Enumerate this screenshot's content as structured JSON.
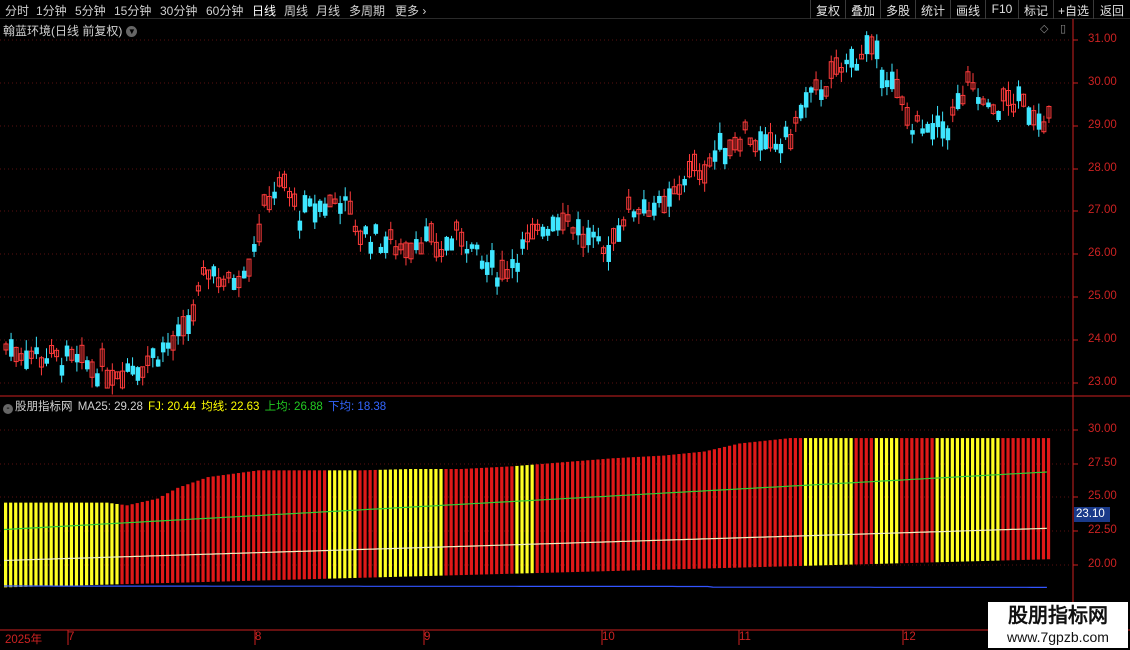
{
  "toolbar": {
    "timeframes": [
      "分时",
      "1分钟",
      "5分钟",
      "15分钟",
      "30分钟",
      "60分钟",
      "日线",
      "周线",
      "月线",
      "多周期",
      "更多"
    ],
    "more_arrow": "›",
    "right_buttons": [
      "复权",
      "叠加",
      "多股",
      "统计",
      "画线",
      "F10",
      "标记",
      "+自选",
      "返回"
    ]
  },
  "main_chart": {
    "title": "翰蓝环境(日线 前复权)",
    "y_ticks": [
      "31.00",
      "30.00",
      "29.00",
      "28.00",
      "27.00",
      "26.00",
      "25.00",
      "24.00",
      "23.00"
    ],
    "colors": {
      "up": "#ff3333",
      "down": "#33e6ff",
      "grid": "#6b1010"
    }
  },
  "indicator": {
    "name": "股朋指标网",
    "ma25": "MA25: 29.28",
    "fj": "FJ: 20.44",
    "junxian": "均线: 22.63",
    "shangjun": "上均: 26.88",
    "xiajun": "下均: 18.38",
    "y_ticks": [
      "30.00",
      "27.50",
      "25.00",
      "22.50",
      "20.00"
    ],
    "current_value": "23.10"
  },
  "x_axis": {
    "labels": [
      "2025年",
      "7",
      "8",
      "9",
      "10",
      "11",
      "12"
    ]
  },
  "watermark": {
    "title": "股朋指标网",
    "url": "www.7gpzb.com"
  }
}
